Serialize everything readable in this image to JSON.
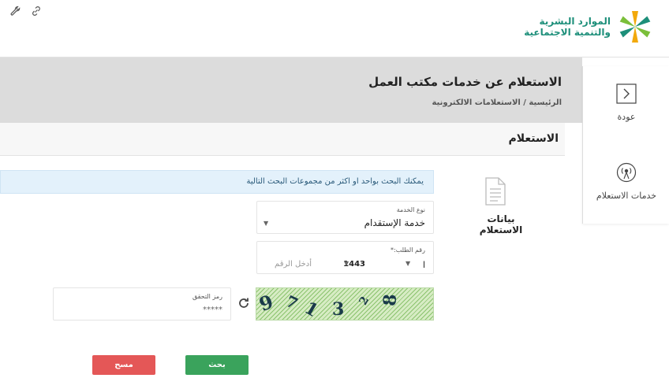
{
  "header": {
    "logo_line1": "الموارد البشرية",
    "logo_line2": "والتنمية الاجتماعية",
    "tool_icons": [
      "wrench-icon",
      "link-icon"
    ]
  },
  "page": {
    "title": "الاستعلام عن خدمات مكتب العمل",
    "breadcrumb": "الرئيسية / الاستعلامات الالكترونية"
  },
  "sidebar": {
    "items": [
      {
        "label": "عودة",
        "icon": "arrow-right-icon"
      },
      {
        "label": "خدمات الاستعلام",
        "icon": "broadcast-icon"
      }
    ]
  },
  "card": {
    "title": "الاستعلام",
    "section_label": "بيانات الاستعلام",
    "info": "يمكنك البحث بواحد او اكثر من مجموعات البحث التالية"
  },
  "form": {
    "service_type": {
      "label": "نوع الخدمة",
      "value": "خدمة الإستقدام"
    },
    "request_number": {
      "label": "رقم الطلب:*",
      "prefix": "ا",
      "year": "1443",
      "placeholder": "أدخل الرقم"
    },
    "captcha": {
      "label": "رمز التحقق",
      "value": "*****",
      "digits": [
        "9",
        "7",
        "1",
        "3",
        "2",
        "8"
      ]
    }
  },
  "buttons": {
    "search": "بحث",
    "clear": "مسح"
  },
  "colors": {
    "brand_green": "#1d8f7a",
    "search_button": "#3aa35c",
    "clear_button": "#e45757",
    "info_background": "#e3f1fb"
  }
}
